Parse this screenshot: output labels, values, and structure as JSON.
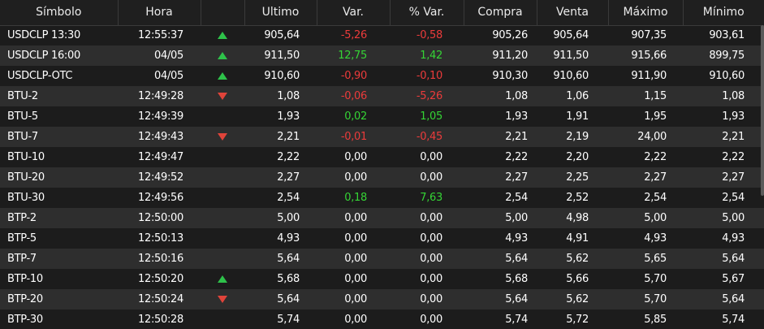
{
  "columns": {
    "simbolo": "Símbolo",
    "hora": "Hora",
    "arrow": "",
    "ultimo": "Ultimo",
    "var": "Var.",
    "pvar": "% Var.",
    "compra": "Compra",
    "venta": "Venta",
    "maximo": "Máximo",
    "minimo": "Mínimo"
  },
  "colors": {
    "positive": "#35d435",
    "negative": "#ec3b3b",
    "neutral": "#ffffff",
    "row_dark": "#1c1c1c",
    "row_light": "#2e2e2e"
  },
  "rows": [
    {
      "simbolo": "USDCLP 13:30",
      "hora": "12:55:37",
      "arrow": "up-arrow-icon",
      "ultimo": "905,64",
      "var": "-5,26",
      "pvar": "-0,58",
      "trend": "neg",
      "compra": "905,26",
      "venta": "905,64",
      "maximo": "907,35",
      "minimo": "903,61"
    },
    {
      "simbolo": "USDCLP 16:00",
      "hora": "04/05",
      "arrow": "up-arrow-icon",
      "ultimo": "911,50",
      "var": "12,75",
      "pvar": "1,42",
      "trend": "pos",
      "compra": "911,20",
      "venta": "911,50",
      "maximo": "915,66",
      "minimo": "899,75"
    },
    {
      "simbolo": "USDCLP-OTC",
      "hora": "04/05",
      "arrow": "up-arrow-icon",
      "ultimo": "910,60",
      "var": "-0,90",
      "pvar": "-0,10",
      "trend": "neg",
      "compra": "910,30",
      "venta": "910,60",
      "maximo": "911,90",
      "minimo": "910,60"
    },
    {
      "simbolo": "BTU-2",
      "hora": "12:49:28",
      "arrow": "down-arrow-icon",
      "ultimo": "1,08",
      "var": "-0,06",
      "pvar": "-5,26",
      "trend": "neg",
      "compra": "1,08",
      "venta": "1,06",
      "maximo": "1,15",
      "minimo": "1,08"
    },
    {
      "simbolo": "BTU-5",
      "hora": "12:49:39",
      "arrow": "",
      "ultimo": "1,93",
      "var": "0,02",
      "pvar": "1,05",
      "trend": "pos",
      "compra": "1,93",
      "venta": "1,91",
      "maximo": "1,95",
      "minimo": "1,93"
    },
    {
      "simbolo": "BTU-7",
      "hora": "12:49:43",
      "arrow": "down-arrow-icon",
      "ultimo": "2,21",
      "var": "-0,01",
      "pvar": "-0,45",
      "trend": "neg",
      "compra": "2,21",
      "venta": "2,19",
      "maximo": "24,00",
      "minimo": "2,21"
    },
    {
      "simbolo": "BTU-10",
      "hora": "12:49:47",
      "arrow": "",
      "ultimo": "2,22",
      "var": "0,00",
      "pvar": "0,00",
      "trend": "flat",
      "compra": "2,22",
      "venta": "2,20",
      "maximo": "2,22",
      "minimo": "2,22"
    },
    {
      "simbolo": "BTU-20",
      "hora": "12:49:52",
      "arrow": "",
      "ultimo": "2,27",
      "var": "0,00",
      "pvar": "0,00",
      "trend": "flat",
      "compra": "2,27",
      "venta": "2,25",
      "maximo": "2,27",
      "minimo": "2,27"
    },
    {
      "simbolo": "BTU-30",
      "hora": "12:49:56",
      "arrow": "",
      "ultimo": "2,54",
      "var": "0,18",
      "pvar": "7,63",
      "trend": "pos",
      "compra": "2,54",
      "venta": "2,52",
      "maximo": "2,54",
      "minimo": "2,54"
    },
    {
      "simbolo": "BTP-2",
      "hora": "12:50:00",
      "arrow": "",
      "ultimo": "5,00",
      "var": "0,00",
      "pvar": "0,00",
      "trend": "flat",
      "compra": "5,00",
      "venta": "4,98",
      "maximo": "5,00",
      "minimo": "5,00"
    },
    {
      "simbolo": "BTP-5",
      "hora": "12:50:13",
      "arrow": "",
      "ultimo": "4,93",
      "var": "0,00",
      "pvar": "0,00",
      "trend": "flat",
      "compra": "4,93",
      "venta": "4,91",
      "maximo": "4,93",
      "minimo": "4,93"
    },
    {
      "simbolo": "BTP-7",
      "hora": "12:50:16",
      "arrow": "",
      "ultimo": "5,64",
      "var": "0,00",
      "pvar": "0,00",
      "trend": "flat",
      "compra": "5,64",
      "venta": "5,62",
      "maximo": "5,65",
      "minimo": "5,64"
    },
    {
      "simbolo": "BTP-10",
      "hora": "12:50:20",
      "arrow": "up-arrow-icon",
      "ultimo": "5,68",
      "var": "0,00",
      "pvar": "0,00",
      "trend": "flat",
      "compra": "5,68",
      "venta": "5,66",
      "maximo": "5,70",
      "minimo": "5,67"
    },
    {
      "simbolo": "BTP-20",
      "hora": "12:50:24",
      "arrow": "down-arrow-icon",
      "ultimo": "5,64",
      "var": "0,00",
      "pvar": "0,00",
      "trend": "flat",
      "compra": "5,64",
      "venta": "5,62",
      "maximo": "5,70",
      "minimo": "5,64"
    },
    {
      "simbolo": "BTP-30",
      "hora": "12:50:28",
      "arrow": "",
      "ultimo": "5,74",
      "var": "0,00",
      "pvar": "0,00",
      "trend": "flat",
      "compra": "5,74",
      "venta": "5,72",
      "maximo": "5,85",
      "minimo": "5,74"
    }
  ]
}
